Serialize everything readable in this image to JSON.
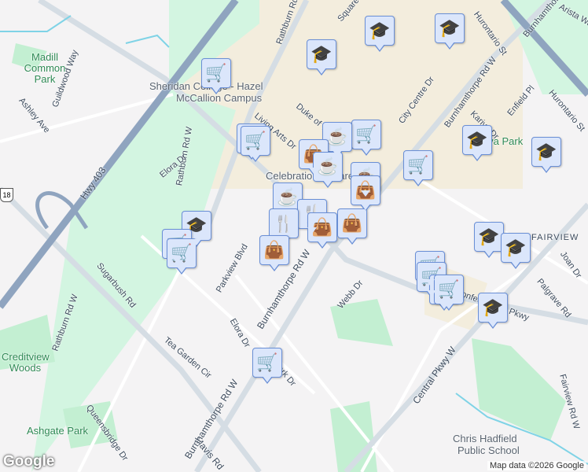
{
  "labels": {
    "madill": "Madill Common Park",
    "ashley": "Ashley Ave",
    "guildwood": "Guildwood Way",
    "sheridan1": "Sheridan College - Hazel",
    "sheridan2": "McCallion Campus",
    "living_arts": "Living Arts Dr",
    "duke": "Duke of York",
    "rathburn_n": "Rathburn Rd",
    "square": "Square One",
    "city_centre": "City Centre Dr",
    "burnham_ne": "Burnhamthorpe Rd W",
    "burnham_far": "Burnhamthorpe Rd W",
    "ontario": "Hurontario St",
    "hurontario": "Hurontario St",
    "kariya": "Kariya Dr",
    "enfield": "Enfield Pl",
    "kariya_park": "Kariya Park",
    "arista": "Arista Way",
    "celebration": "Celebration Square",
    "hwy403": "Hwy 403",
    "hwy18": "18",
    "rathburn_w": "Rathburn Rd W",
    "elora1": "Elora Dr",
    "elora2": "Elora Dr",
    "sugarbush": "Sugarbush Rd",
    "parkview": "Parkview Blvd",
    "tea_garden": "Tea Garden Cir",
    "creditview": "Creditview Woods",
    "ashgate": "Ashgate Park",
    "queensbridge": "Queensbridge Dr",
    "mavis": "Mavis Rd",
    "webb": "Webb Dr",
    "central": "Central Pkwy W",
    "fairview": "FAIRVIEW",
    "joan": "Joan Dr",
    "palgrave": "Palgrave Rd",
    "fairview_rd": "Fairview Rd W",
    "chris1": "Chris Hadfield",
    "chris2": "Public School",
    "rathburn_sw": "Rathburn Rd W",
    "burnham_s": "Burnhamthorpe Rd W",
    "burnham_sw": "Burnhamthorpe Rd W",
    "confed": "Confederation Pkwy",
    "park_dr": "Park Dr",
    "cele": "Celebration"
  },
  "icons": {
    "cart": "🛒",
    "edu": "🎓",
    "coffee": "☕",
    "bag": "👜",
    "food": "🍴"
  },
  "attribution": "Map data ©2026 Google",
  "logo": "Google"
}
